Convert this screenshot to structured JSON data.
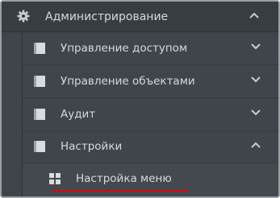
{
  "menu": {
    "header": {
      "label": "Администрирование",
      "icon": "gear-icon",
      "expanded": true
    },
    "items": [
      {
        "label": "Управление доступом",
        "icon": "document-icon",
        "expanded": false
      },
      {
        "label": "Управление объектами",
        "icon": "document-icon",
        "expanded": false
      },
      {
        "label": "Аудит",
        "icon": "document-icon",
        "expanded": false
      },
      {
        "label": "Настройки",
        "icon": "document-icon",
        "expanded": true
      }
    ],
    "subitems": [
      {
        "label": "Настройка меню",
        "icon": "grid-icon"
      }
    ]
  },
  "colors": {
    "panel_bg": "#3b4045",
    "text": "#d6dadd",
    "highlight_underline": "#b0191f"
  }
}
